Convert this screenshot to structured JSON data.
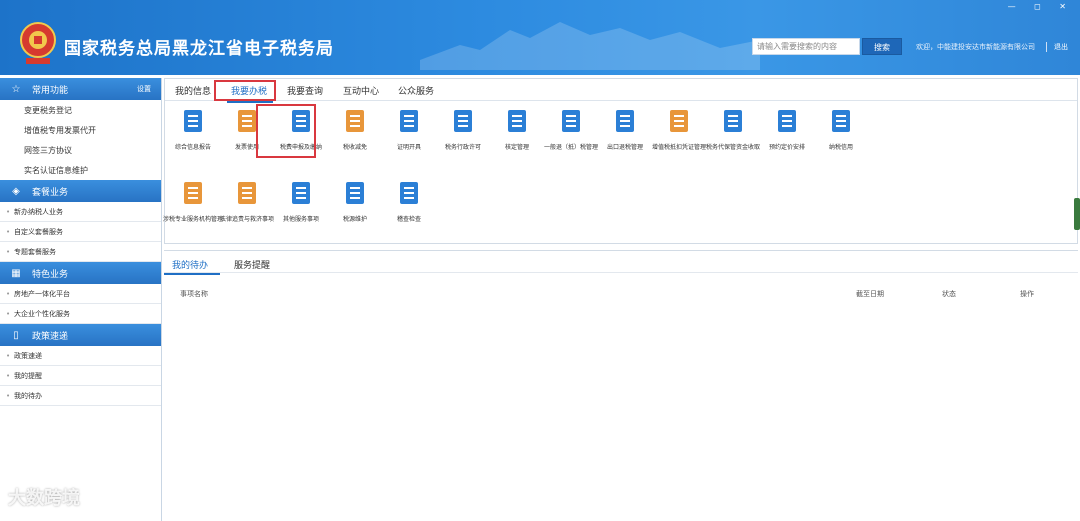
{
  "header": {
    "site_title": "国家税务总局黑龙江省电子税务局",
    "search_placeholder": "请输入需要搜索的内容",
    "search_button": "搜索",
    "welcome_text": "欢迎，中能建投安达市新能源有限公司",
    "logout": "退出",
    "window_controls": "— ◻ ✕"
  },
  "sidebar": {
    "sections": [
      {
        "title": "常用功能",
        "icon": "star-icon",
        "setting": "设置",
        "items": [
          "变更税务登记",
          "增值税专用发票代开",
          "网签三方协议",
          "实名认证信息维护"
        ]
      },
      {
        "title": "套餐业务",
        "icon": "layers-icon",
        "items": [
          "新办纳税人业务",
          "自定义套餐服务",
          "专题套餐服务"
        ]
      },
      {
        "title": "特色业务",
        "icon": "grid-icon",
        "items": [
          "房地产一体化平台",
          "大企业个性化服务"
        ]
      },
      {
        "title": "政策速递",
        "icon": "book-icon",
        "items": [
          "政策速递",
          "我的提醒",
          "我的待办"
        ]
      }
    ]
  },
  "main": {
    "tabs": [
      "我的信息",
      "我要办税",
      "我要查询",
      "互动中心",
      "公众服务"
    ],
    "active_tab": "我要办税",
    "tiles_row1": [
      {
        "label": "综合信息报告",
        "icon": "report-icon",
        "color": "#2b7fd6"
      },
      {
        "label": "发票使用",
        "icon": "invoice-icon",
        "color": "#e8963a"
      },
      {
        "label": "税费申报及缴纳",
        "icon": "declare-icon",
        "color": "#2b7fd6"
      },
      {
        "label": "税收减免",
        "icon": "moneybag-icon",
        "color": "#e8963a"
      },
      {
        "label": "证明开具",
        "icon": "certificate-icon",
        "color": "#2b7fd6"
      },
      {
        "label": "税务行政许可",
        "icon": "license-icon",
        "color": "#2b7fd6"
      },
      {
        "label": "核定管理",
        "icon": "users-icon",
        "color": "#2b7fd6"
      },
      {
        "label": "一般退（抵）税管理",
        "icon": "refund-icon",
        "color": "#2b7fd6"
      },
      {
        "label": "出口退税管理",
        "icon": "globe-icon",
        "color": "#2b7fd6"
      },
      {
        "label": "增值税抵扣凭证管理",
        "icon": "barchart-icon",
        "color": "#e8963a"
      },
      {
        "label": "税务代保管资金收取",
        "icon": "safe-icon",
        "color": "#2b7fd6"
      },
      {
        "label": "预约定价安排",
        "icon": "balloon-icon",
        "color": "#2b7fd6"
      },
      {
        "label": "纳税信用",
        "icon": "plant-icon",
        "color": "#2b7fd6"
      }
    ],
    "tiles_row2": [
      {
        "label": "涉税专业服务机构管理",
        "icon": "house-icon",
        "color": "#e8963a"
      },
      {
        "label": "法律追责与救济事项",
        "icon": "scale-icon",
        "color": "#e8963a"
      },
      {
        "label": "其他服务事项",
        "icon": "hand-icon",
        "color": "#2b7fd6"
      },
      {
        "label": "税源维护",
        "icon": "building-icon",
        "color": "#2b7fd6"
      },
      {
        "label": "稽查检查",
        "icon": "pin-icon",
        "color": "#2b7fd6"
      }
    ],
    "bottom_tabs": [
      "我的待办",
      "服务提醒"
    ],
    "active_bottom_tab": "我的待办",
    "table_headers": {
      "name": "事项名称",
      "deadline": "截至日期",
      "status": "状态",
      "action": "操作"
    }
  },
  "watermark": "大数跨境"
}
